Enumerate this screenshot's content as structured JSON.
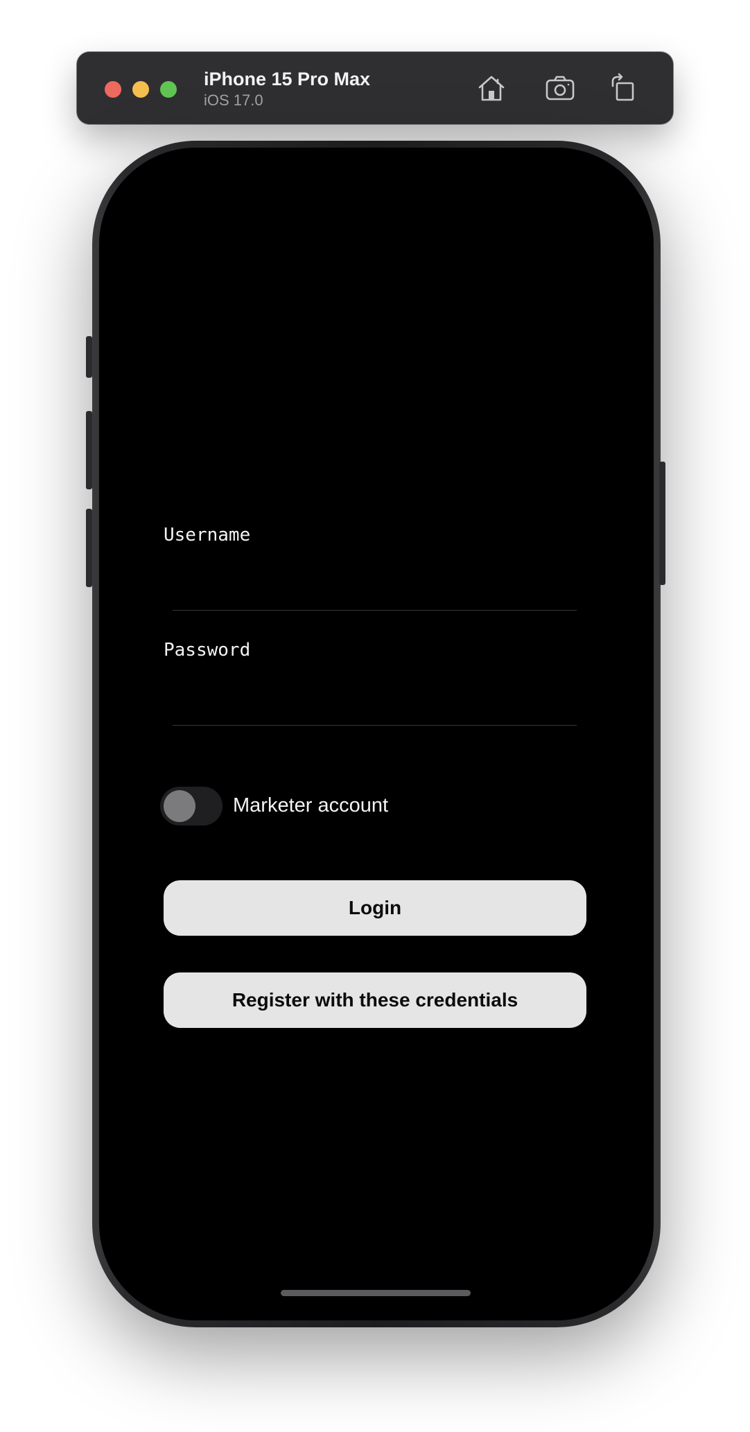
{
  "simulator": {
    "device_name": "iPhone 15 Pro Max",
    "os_version": "iOS 17.0",
    "traffic_lights": {
      "close_color": "#ec6a5e",
      "minimize_color": "#f4bf4f",
      "zoom_color": "#61c554"
    },
    "toolbar_icons": [
      "home-icon",
      "screenshot-icon",
      "rotate-icon"
    ]
  },
  "login_form": {
    "username": {
      "label": "Username",
      "value": "",
      "placeholder": ""
    },
    "password": {
      "label": "Password",
      "value": "",
      "placeholder": ""
    },
    "marketer_toggle": {
      "label": "Marketer account",
      "checked": false
    },
    "login_button_label": "Login",
    "register_button_label": "Register with these credentials"
  },
  "colors": {
    "screen_background": "#000000",
    "button_background": "#e5e5e5",
    "button_text": "#0c0c0c",
    "label_text": "#f4f4f4"
  }
}
